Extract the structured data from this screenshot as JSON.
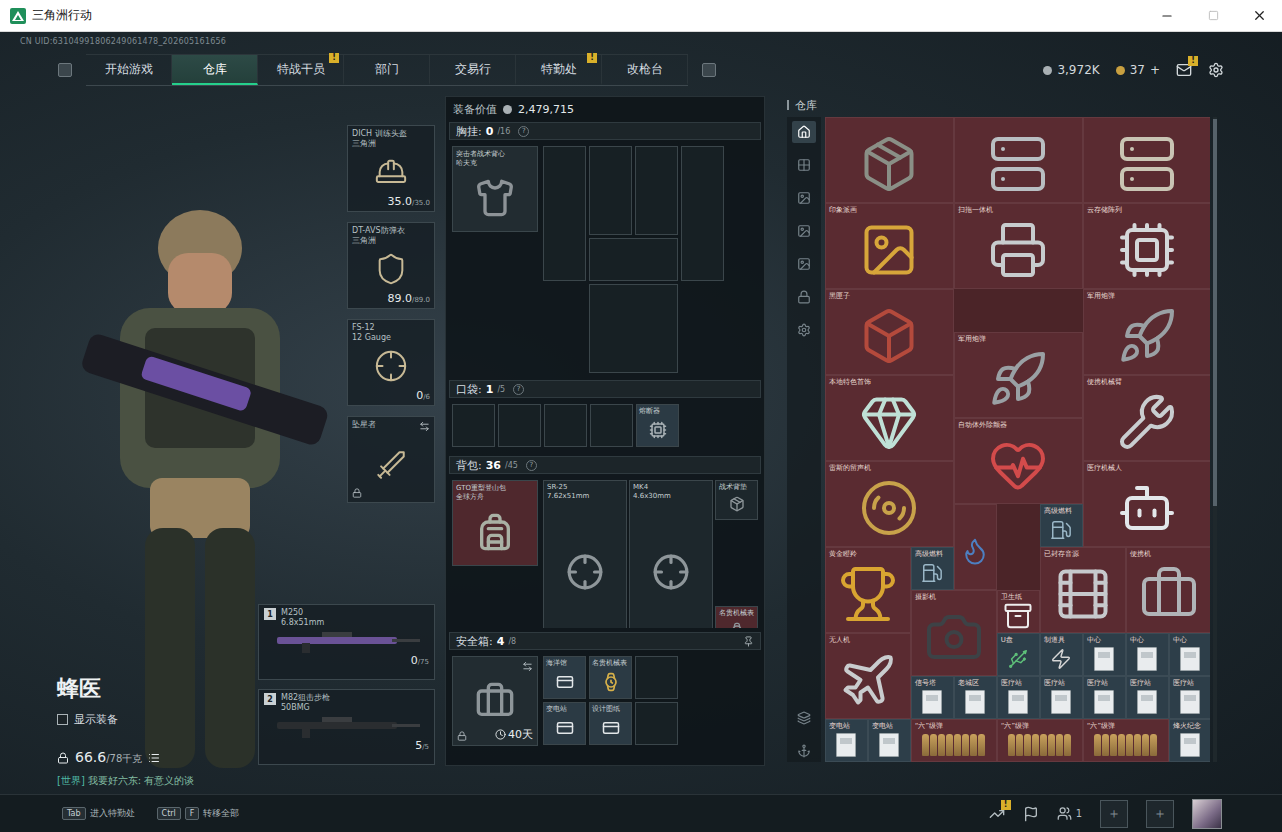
{
  "window": {
    "title": "三角洲行动"
  },
  "uid": "CN UID:63104991806249061478_202605161656",
  "nav": {
    "tabs": [
      {
        "label": "开始游戏",
        "selected": false,
        "badge": ""
      },
      {
        "label": "仓库",
        "selected": true,
        "badge": ""
      },
      {
        "label": "特战干员",
        "selected": false,
        "badge": "!"
      },
      {
        "label": "部门",
        "selected": false,
        "badge": ""
      },
      {
        "label": "交易行",
        "selected": false,
        "badge": ""
      },
      {
        "label": "特勤处",
        "selected": false,
        "badge": "!"
      },
      {
        "label": "改枪台",
        "selected": false,
        "badge": ""
      }
    ],
    "coins": "3,972K",
    "tickets": "37",
    "add": "+",
    "mail_badge": "!"
  },
  "character": {
    "name": "蜂医",
    "show_equipment": {
      "label": "显示装备",
      "checked": false
    },
    "weight": "66.6",
    "capacity": "/78千克",
    "chat": {
      "channel": "[世界]",
      "text": "我要好六东: 有意义的谈"
    }
  },
  "gear": [
    {
      "name": "DICH 训练头盔",
      "sub": "三角洲",
      "reading": "35.0",
      "max": "/35.0",
      "locked": false,
      "swap": false
    },
    {
      "name": "DT-AVS防弹衣",
      "sub": "三角洲",
      "reading": "89.0",
      "max": "/89.0",
      "locked": false,
      "swap": false
    },
    {
      "name": "FS-12",
      "sub": "12 Gauge",
      "reading": "0",
      "max": "/6",
      "locked": false,
      "swap": false
    },
    {
      "name": "坠星者",
      "sub": "",
      "reading": "",
      "max": "",
      "locked": true,
      "swap": true
    }
  ],
  "weapons": [
    {
      "slot": "1",
      "name": "M250",
      "caliber": "6.8x51mm",
      "reading": "0",
      "max": "/75"
    },
    {
      "slot": "2",
      "name": "M82狙击步枪",
      "caliber": "50BMG",
      "reading": "5",
      "max": "/5"
    }
  ],
  "loadout": {
    "value_label": "装备价值",
    "value": "2,479,715",
    "rig": {
      "title": "胸挂",
      "count": "0",
      "capacity": "/16",
      "help": "?",
      "item": "突击者战术背心",
      "item_sub": "哈夫克"
    },
    "pockets": {
      "title": "口袋",
      "count": "1",
      "capacity": "/5",
      "help": "?",
      "items": [
        {
          "label": "",
          "filled": false
        },
        {
          "label": "",
          "filled": false
        },
        {
          "label": "",
          "filled": false
        },
        {
          "label": "",
          "filled": false
        },
        {
          "label": "熔断器",
          "filled": true
        }
      ]
    },
    "backpack": {
      "title": "背包",
      "count": "36",
      "capacity": "/45",
      "help": "?",
      "item": "GTO重型登山包",
      "item_sub": "全球方舟",
      "items": [
        {
          "name": "SR-25",
          "sub": "7.62x51mm"
        },
        {
          "name": "MK4",
          "sub": "4.6x30mm"
        },
        {
          "name": "战术背垫",
          "sub": ""
        },
        {
          "name": "名贵机械表",
          "sub": ""
        }
      ]
    },
    "case": {
      "title": "安全箱",
      "count": "4",
      "capacity": "/8",
      "duration": "40天",
      "items": [
        {
          "label": "海洋馆"
        },
        {
          "label": "名贵机械表"
        },
        {
          "label": ""
        },
        {
          "label": "变电站"
        },
        {
          "label": "设计图纸"
        },
        {
          "label": ""
        }
      ]
    }
  },
  "stash": {
    "title": "仓库",
    "sidebar": [
      {
        "selected": true
      },
      {
        "selected": false
      },
      {
        "selected": false
      },
      {
        "selected": false
      },
      {
        "selected": false
      },
      {
        "selected": false
      },
      {
        "selected": false
      },
      {
        "selected": false
      },
      {
        "selected": false
      }
    ],
    "items": [
      {
        "label": "",
        "kind": "object"
      },
      {
        "label": "",
        "kind": "object"
      },
      {
        "label": "",
        "kind": "object"
      },
      {
        "label": "印象派画",
        "kind": "object"
      },
      {
        "label": "扫拖一体机",
        "kind": "object"
      },
      {
        "label": "云存储阵列",
        "kind": "object"
      },
      {
        "label": "黑匣子",
        "kind": "object"
      },
      {
        "label": "军用炮弹",
        "kind": "object"
      },
      {
        "label": "军用炮弹",
        "kind": "object"
      },
      {
        "label": "本地特色首饰",
        "kind": "object"
      },
      {
        "label": "自动体外除颤器",
        "kind": "object"
      },
      {
        "label": "便携机械臂",
        "kind": "object"
      },
      {
        "label": "雷斯的留声机",
        "kind": "object"
      },
      {
        "label": "医疗机械人",
        "kind": "object"
      },
      {
        "label": "高级燃料",
        "kind": "small"
      },
      {
        "label": "黄金瞪羚",
        "kind": "object"
      },
      {
        "label": "高级燃料",
        "kind": "small"
      },
      {
        "label": "",
        "kind": "object"
      },
      {
        "label": "已封存音源",
        "kind": "object"
      },
      {
        "label": "便携机",
        "kind": "object"
      },
      {
        "label": "摄影机",
        "kind": "object"
      },
      {
        "label": "卫生纸",
        "kind": "object"
      },
      {
        "label": "无人机",
        "kind": "object"
      },
      {
        "label": "U盘",
        "kind": "small"
      },
      {
        "label": "制道具",
        "kind": "small"
      },
      {
        "label": "中心",
        "kind": "card"
      },
      {
        "label": "中心",
        "kind": "card"
      },
      {
        "label": "中心",
        "kind": "card"
      },
      {
        "label": "信号塔",
        "kind": "card"
      },
      {
        "label": "老城区",
        "kind": "card"
      },
      {
        "label": "医疗站",
        "kind": "card"
      },
      {
        "label": "医疗站",
        "kind": "card"
      },
      {
        "label": "医疗站",
        "kind": "card"
      },
      {
        "label": "医疗站",
        "kind": "card"
      },
      {
        "label": "医疗站",
        "kind": "card"
      },
      {
        "label": "变电站",
        "kind": "card"
      },
      {
        "label": "变电站",
        "kind": "card"
      },
      {
        "label": "“六”级弹",
        "kind": "ammo"
      },
      {
        "label": "“六”级弹",
        "kind": "ammo"
      },
      {
        "label": "“六”级弹",
        "kind": "ammo"
      },
      {
        "label": "烽火纪念",
        "kind": "card"
      }
    ]
  },
  "bottom": {
    "hints": [
      {
        "keys": [
          "Tab"
        ],
        "label": "进入特勤处"
      },
      {
        "keys": [
          "Ctrl",
          "F"
        ],
        "label": "转移全部"
      }
    ],
    "activity_badge": "!",
    "party": "1"
  }
}
